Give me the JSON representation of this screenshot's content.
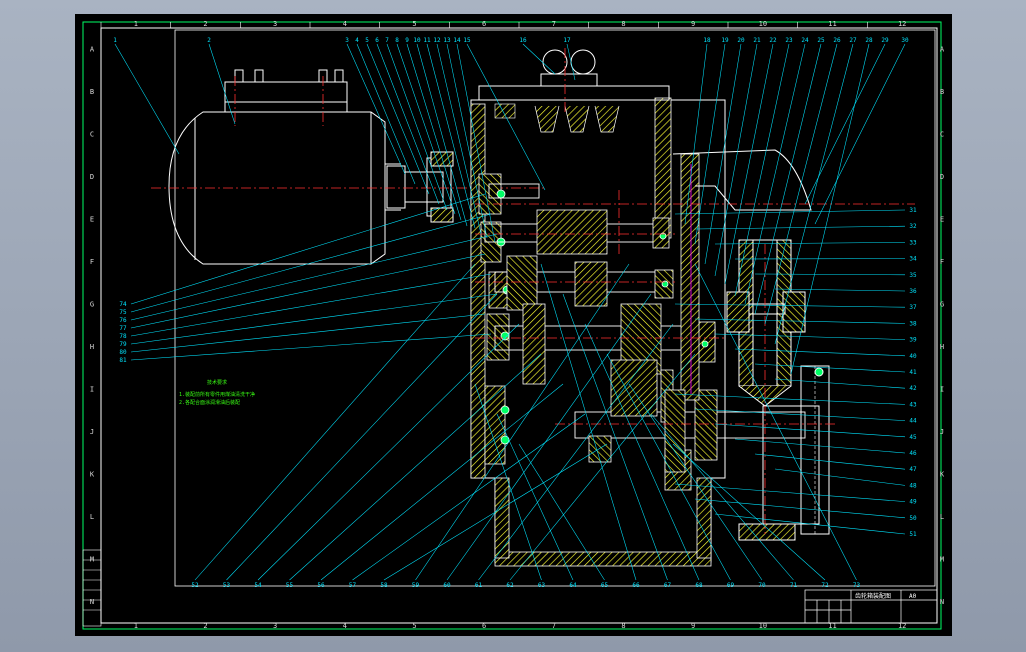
{
  "viewport": {
    "background": "#000000"
  },
  "frame": {
    "top_ticks": [
      "1",
      "2",
      "3",
      "4",
      "5",
      "6",
      "7",
      "8",
      "9",
      "10",
      "11",
      "12"
    ],
    "bottom_ticks": [
      "1",
      "2",
      "3",
      "4",
      "5",
      "6",
      "7",
      "8",
      "9",
      "10",
      "11",
      "12"
    ],
    "right_ticks": [
      "A",
      "B",
      "C",
      "D",
      "E",
      "F",
      "G",
      "H",
      "I",
      "J",
      "K",
      "L",
      "M",
      "N"
    ],
    "left_ticks": [
      "A",
      "B",
      "C",
      "D",
      "E",
      "F",
      "G",
      "H",
      "I",
      "J",
      "K",
      "L",
      "M",
      "N"
    ]
  },
  "balloons_top": [
    "1",
    "2",
    "3",
    "4",
    "5",
    "6",
    "7",
    "8",
    "9",
    "10",
    "11",
    "12",
    "13",
    "14",
    "15",
    "16",
    "17",
    "18",
    "19",
    "20",
    "21",
    "22",
    "23",
    "24",
    "25",
    "26",
    "27",
    "28",
    "29",
    "30"
  ],
  "balloons_right": [
    "31",
    "32",
    "33",
    "34",
    "35",
    "36",
    "37",
    "38",
    "39",
    "40",
    "41",
    "42",
    "43",
    "44",
    "45",
    "46",
    "47",
    "48",
    "49",
    "50",
    "51"
  ],
  "balloons_bottom": [
    "52",
    "53",
    "54",
    "55",
    "56",
    "57",
    "58",
    "59",
    "60",
    "61",
    "62",
    "63",
    "64",
    "65",
    "66",
    "67",
    "68",
    "69",
    "70",
    "71",
    "72",
    "73"
  ],
  "balloons_left": [
    "74",
    "75",
    "76",
    "77",
    "78",
    "79",
    "80",
    "81"
  ],
  "notes": {
    "title": "技术要求",
    "lines": [
      "1.装配前所有零件用煤油清洗干净",
      "2.各配合面涂润滑油后装配"
    ]
  },
  "title_block": {
    "drawing_name": "齿轮箱装配图",
    "sheet": "A0"
  },
  "colors": {
    "outline": "#ffffff",
    "leader": "#00e5ff",
    "center": "#ff3030",
    "section": "#ffff33",
    "hidden": "#ff00ff",
    "text": "#39ff14",
    "frame": "#00ff66"
  }
}
